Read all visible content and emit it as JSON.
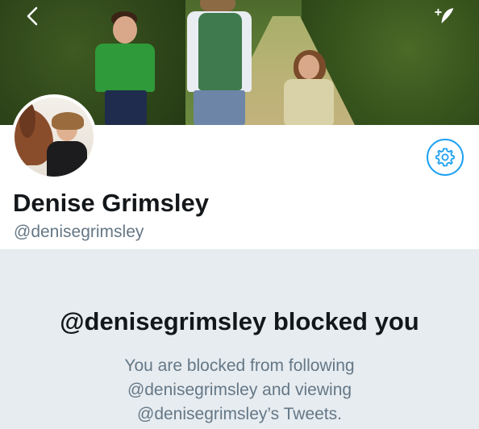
{
  "nav": {
    "back_icon": "chevron-left-icon",
    "compose_icon": "compose-tweet-icon"
  },
  "profile": {
    "name": "Denise Grimsley",
    "handle": "@denisegrimsley",
    "settings_icon": "gear-icon"
  },
  "blocked": {
    "title": "@denisegrimsley blocked you",
    "lines": [
      "You are blocked from following",
      "@denisegrimsley and viewing",
      "@denisegrimsley’s Tweets."
    ]
  },
  "colors": {
    "accent": "#1da1f2",
    "panel_bg": "#e6ecf0",
    "primary_text": "#14171a",
    "secondary_text": "#657786"
  }
}
